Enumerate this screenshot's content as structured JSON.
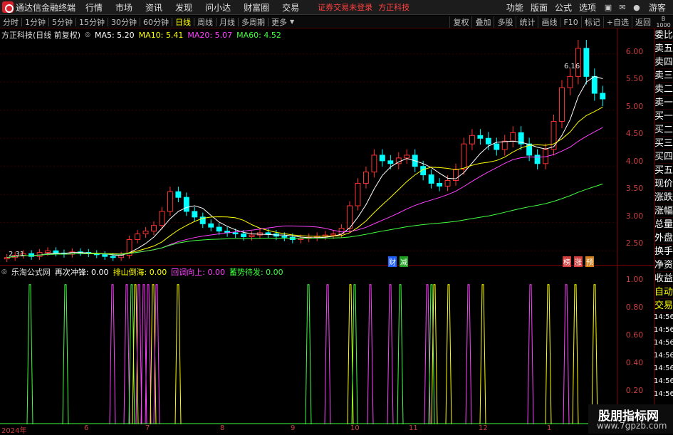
{
  "menubar": {
    "app_name": "通达信金融终端",
    "items": [
      "行情",
      "市场",
      "资讯",
      "发现",
      "问小达",
      "财富圈",
      "交易"
    ],
    "warning": "证券交易未登录",
    "broker": "方正科技",
    "right_items": [
      "功能",
      "版面",
      "公式",
      "选项"
    ],
    "guest": "游客"
  },
  "periodbar": {
    "items": [
      "分时",
      "1分钟",
      "5分钟",
      "15分钟",
      "30分钟",
      "60分钟",
      "日线",
      "周线",
      "月线",
      "多周期",
      "更多"
    ],
    "active": "日线",
    "tools": [
      "复权",
      "叠加",
      "多股",
      "统计",
      "画线",
      "F10",
      "标记",
      "+自选",
      "返回"
    ]
  },
  "side_icon": {
    "line1": "B",
    "line2": "1000"
  },
  "sidepanel": {
    "items": [
      "委比",
      "卖五",
      "卖四",
      "卖三",
      "卖二",
      "卖一",
      "买一",
      "买二",
      "买三",
      "买四",
      "买五",
      "现价",
      "涨跌",
      "涨幅",
      "总量",
      "外盘",
      "换手",
      "净资",
      "收益",
      "自动",
      "交易"
    ]
  },
  "main_chart": {
    "title": "方正科技(日线 前复权)",
    "ma": [
      {
        "label": "MA5: 5.20",
        "color": "#ffffff"
      },
      {
        "label": "MA10: 5.41",
        "color": "#ffff00"
      },
      {
        "label": "MA20: 5.07",
        "color": "#ff40ff"
      },
      {
        "label": "MA60: 4.52",
        "color": "#40ff40"
      }
    ],
    "high_label": "6.16",
    "low_label": "2.31",
    "y_ticks": [
      "6.00",
      "5.50",
      "5.00",
      "4.50",
      "4.00",
      "3.50",
      "3.00",
      "2.50"
    ],
    "tags": [
      {
        "text": "财",
        "color": "#2060ff"
      },
      {
        "text": "减",
        "color": "#20a020"
      },
      {
        "text": "榜",
        "color": "#d04040"
      },
      {
        "text": "涨",
        "color": "#d04040"
      },
      {
        "text": "预",
        "color": "#d08020"
      }
    ]
  },
  "indicator": {
    "title": "乐淘公式网",
    "items": [
      {
        "label": "再次冲锋: 0.00",
        "color": "#ffffff"
      },
      {
        "label": "排山倒海: 0.00",
        "color": "#ffff00"
      },
      {
        "label": "回调向上: 0.00",
        "color": "#ff40ff"
      },
      {
        "label": "蓄势待发: 0.00",
        "color": "#40ff40"
      }
    ],
    "y_ticks": [
      "1.00",
      "0.80",
      "0.60",
      "0.40",
      "0.20"
    ],
    "time_ticks": [
      "14:56",
      "14:56",
      "14:56",
      "14:56",
      "14:56",
      "14:56",
      "14:56"
    ]
  },
  "date_axis": [
    "2024年",
    "6",
    "7",
    "8",
    "9",
    "10",
    "11",
    "12",
    "1"
  ],
  "watermark": {
    "line1": "股朋指标网",
    "line2": "www.7gpzb.com"
  },
  "chart_data": [
    {
      "type": "candlestick",
      "title": "方正科技(日线 前复权)",
      "ylim": [
        2.25,
        6.25
      ],
      "x_months": [
        "2024年",
        "6",
        "7",
        "8",
        "9",
        "10",
        "11",
        "12",
        "1"
      ],
      "closes": [
        2.38,
        2.42,
        2.45,
        2.4,
        2.47,
        2.5,
        2.46,
        2.44,
        2.48,
        2.47,
        2.45,
        2.43,
        2.4,
        2.38,
        2.42,
        2.7,
        2.8,
        2.85,
        2.95,
        3.2,
        3.55,
        3.45,
        3.2,
        3.1,
        2.98,
        2.92,
        2.85,
        2.82,
        2.8,
        2.75,
        2.78,
        2.82,
        2.8,
        2.76,
        2.74,
        2.7,
        2.72,
        2.74,
        2.76,
        2.78,
        2.8,
        2.9,
        3.3,
        3.7,
        3.9,
        4.2,
        4.1,
        4.05,
        4.15,
        4.2,
        4.0,
        3.85,
        3.7,
        3.65,
        3.75,
        3.95,
        4.4,
        4.55,
        4.5,
        4.4,
        4.3,
        4.45,
        4.6,
        4.4,
        4.2,
        4.05,
        4.3,
        4.8,
        5.4,
        5.6,
        6.1,
        5.6,
        5.3,
        5.2
      ],
      "ma5_last": 5.2,
      "ma10_last": 5.41,
      "ma20_last": 5.07,
      "ma60_last": 4.52,
      "high": 6.16,
      "low": 2.31
    },
    {
      "type": "line",
      "title": "乐淘公式网",
      "ylim": [
        0,
        1.05
      ],
      "series": [
        {
          "name": "再次冲锋",
          "color": "#ffffff"
        },
        {
          "name": "排山倒海",
          "color": "#ffff00"
        },
        {
          "name": "回调向上",
          "color": "#ff40ff"
        },
        {
          "name": "蓄势待发",
          "color": "#40ff40"
        }
      ]
    }
  ]
}
